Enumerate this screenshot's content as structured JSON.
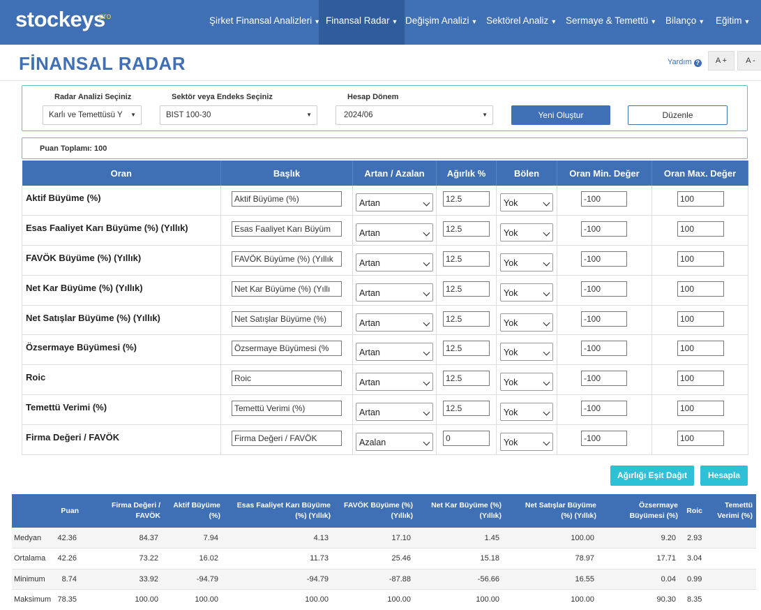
{
  "brand": {
    "logo": "stockeys",
    "tag": "pro"
  },
  "nav": [
    {
      "label": "Şirket Finansal Analizleri"
    },
    {
      "label": "Finansal Radar"
    },
    {
      "label": "Değişim Analizi"
    },
    {
      "label": "Sektörel Analiz"
    },
    {
      "label": "Sermaye & Temettü"
    },
    {
      "label": "Bilanço"
    },
    {
      "label": "Eğitim"
    }
  ],
  "page": {
    "title": "FİNANSAL RADAR",
    "help": "Yardım",
    "help_icon": "?",
    "font_plus": "A +",
    "font_minus": "A -"
  },
  "form": {
    "radar_label": "Radar Analizi Seçiniz",
    "radar_value": "Karlı ve Temettüsü Y",
    "sector_label": "Sektör veya Endeks Seçiniz",
    "sector_value": "BIST 100-30",
    "period_label": "Hesap Dönem",
    "period_value": "2024/06",
    "new_button": "Yeni Oluştur",
    "edit_button": "Düzenle"
  },
  "total": {
    "label": "Puan Toplamı: 100"
  },
  "ratio_table": {
    "headers": [
      "Oran",
      "Başlık",
      "Artan / Azalan",
      "Ağırlık %",
      "Bölen",
      "Oran Min. Değer",
      "Oran Max. Değer"
    ],
    "rows": [
      {
        "name": "Aktif Büyüme (%)",
        "title": "Aktif Büyüme (%)",
        "direction": "Artan",
        "weight": "12.5",
        "divisor": "Yok",
        "min": "-100",
        "max": "100"
      },
      {
        "name": "Esas Faaliyet Karı Büyüme (%) (Yıllık)",
        "title": "Esas Faaliyet Karı Büyüm",
        "direction": "Artan",
        "weight": "12.5",
        "divisor": "Yok",
        "min": "-100",
        "max": "100"
      },
      {
        "name": "FAVÖK Büyüme (%) (Yıllık)",
        "title": "FAVÖK Büyüme (%) (Yıllık",
        "direction": "Artan",
        "weight": "12.5",
        "divisor": "Yok",
        "min": "-100",
        "max": "100"
      },
      {
        "name": "Net Kar Büyüme (%) (Yıllık)",
        "title": "Net Kar Büyüme (%) (Yıllı",
        "direction": "Artan",
        "weight": "12.5",
        "divisor": "Yok",
        "min": "-100",
        "max": "100"
      },
      {
        "name": "Net Satışlar Büyüme (%) (Yıllık)",
        "title": "Net Satışlar Büyüme (%)",
        "direction": "Artan",
        "weight": "12.5",
        "divisor": "Yok",
        "min": "-100",
        "max": "100"
      },
      {
        "name": "Özsermaye Büyümesi (%)",
        "title": "Özsermaye Büyümesi (%",
        "direction": "Artan",
        "weight": "12.5",
        "divisor": "Yok",
        "min": "-100",
        "max": "100"
      },
      {
        "name": "Roic",
        "title": "Roic",
        "direction": "Artan",
        "weight": "12.5",
        "divisor": "Yok",
        "min": "-100",
        "max": "100"
      },
      {
        "name": "Temettü Verimi (%)",
        "title": "Temettü Verimi (%)",
        "direction": "Artan",
        "weight": "12.5",
        "divisor": "Yok",
        "min": "-100",
        "max": "100"
      },
      {
        "name": "Firma Değeri / FAVÖK",
        "title": "Firma Değeri / FAVÖK",
        "direction": "Azalan",
        "weight": "0",
        "divisor": "Yok",
        "min": "-100",
        "max": "100"
      }
    ]
  },
  "actions": {
    "equalize": "Ağırlığı Eşit Dağıt",
    "calculate": "Hesapla"
  },
  "results": {
    "headers": [
      [
        ""
      ],
      [
        "Puan"
      ],
      [
        "Firma Değeri /",
        "FAVÖK"
      ],
      [
        "Aktif Büyüme",
        "(%)"
      ],
      [
        "Esas Faaliyet Karı Büyüme",
        "(%) (Yıllık)"
      ],
      [
        "FAVÖK Büyüme (%)",
        "(Yıllık)"
      ],
      [
        "Net Kar Büyüme (%)",
        "(Yıllık)"
      ],
      [
        "Net Satışlar Büyüme",
        "(%) (Yıllık)"
      ],
      [
        "Özsermaye",
        "Büyümesi (%)"
      ],
      [
        "Roic"
      ],
      [
        "Temettü",
        "Verimi (%)"
      ]
    ],
    "rows": [
      [
        "Medyan",
        "42.36",
        "84.37",
        "7.94",
        "4.13",
        "17.10",
        "1.45",
        "100.00",
        "9.20",
        "2.93",
        ""
      ],
      [
        "Ortalama",
        "42.26",
        "73.22",
        "16.02",
        "11.73",
        "25.46",
        "15.18",
        "78.97",
        "17.71",
        "3.04",
        ""
      ],
      [
        "Minimum",
        "8.74",
        "33.92",
        "-94.79",
        "-94.79",
        "-87.88",
        "-56.66",
        "16.55",
        "0.04",
        "0.99",
        ""
      ],
      [
        "Maksimum",
        "78.35",
        "100.00",
        "100.00",
        "100.00",
        "100.00",
        "100.00",
        "100.00",
        "90.30",
        "8.35",
        ""
      ]
    ]
  },
  "colors": {
    "primary": "#3f6fb4",
    "accent": "#2ec0d6",
    "panel_border": "#5bc0be",
    "logo_tag": "#f2c94c"
  }
}
